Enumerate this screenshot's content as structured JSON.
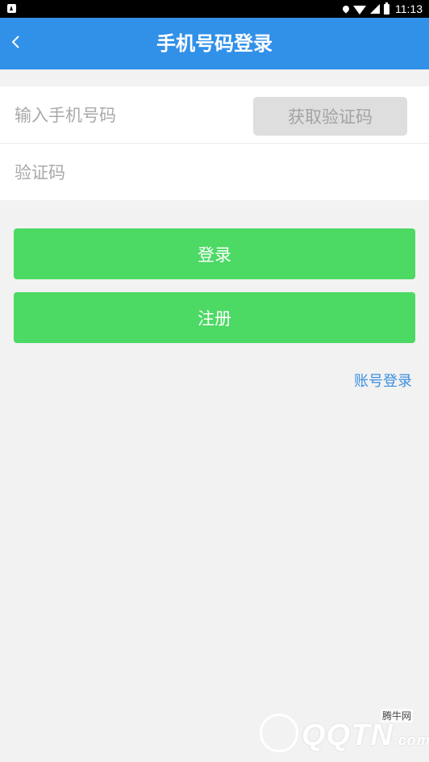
{
  "statusbar": {
    "time": "11:13"
  },
  "header": {
    "title": "手机号码登录"
  },
  "form": {
    "phone_placeholder": "输入手机号码",
    "get_code_label": "获取验证码",
    "code_placeholder": "验证码"
  },
  "actions": {
    "login_label": "登录",
    "register_label": "注册",
    "account_login_label": "账号登录"
  },
  "watermark": {
    "brand": "QQTN",
    "suffix": ".com",
    "small": "腾牛网"
  },
  "colors": {
    "appbar": "#3190e8",
    "button_green": "#4cd964",
    "link_blue": "#3d8fe0",
    "disabled_button": "#dedede"
  },
  "icons": [
    "back-arrow-icon",
    "location-icon",
    "wifi-icon",
    "signal-icon",
    "battery-icon"
  ]
}
